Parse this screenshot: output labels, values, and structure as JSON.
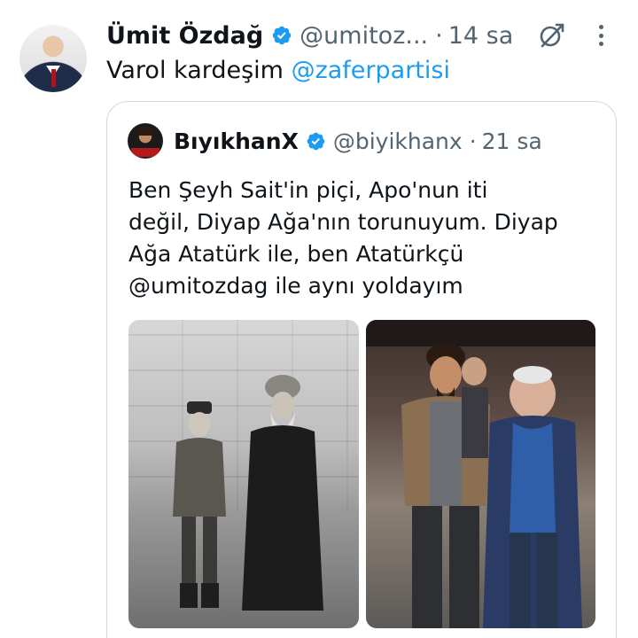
{
  "tweet": {
    "author_name": "Ümit Özdağ",
    "author_handle": "@umitoz...",
    "separator": "·",
    "time": "14 sa",
    "text_prefix": "Varol kardeşim ",
    "text_mention": "@zaferpartisi"
  },
  "quoted_tweet": {
    "author_name": "BıyıkhanX",
    "author_handle": "@biyikhanx",
    "separator": "·",
    "time": "21 sa",
    "text_lines": [
      "Ben Şeyh Sait'in piçi, Apo'nun iti",
      "değil, Diyap Ağa'nın torunuyum. Diyap",
      "Ağa Atatürk ile, ben Atatürkçü",
      "@umitozdag ile  aynı yoldayım"
    ]
  },
  "colors": {
    "accent": "#1d9bf0",
    "text_secondary": "#536471",
    "border": "#cfd9de"
  },
  "icons": [
    "verified-badge-icon",
    "grok-icon",
    "more-options-icon"
  ]
}
